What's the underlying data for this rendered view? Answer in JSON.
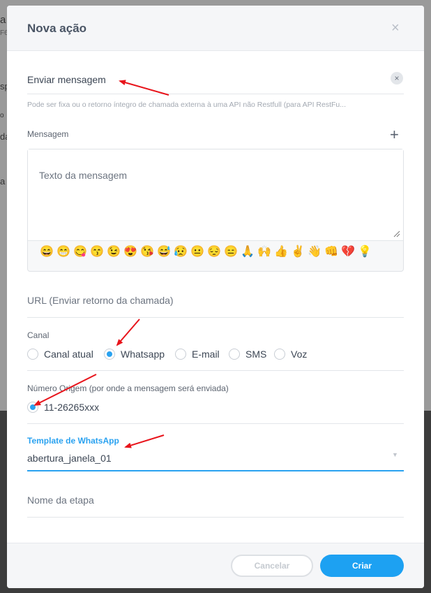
{
  "background": {
    "fragments": [
      "a",
      "F6",
      "sp",
      "o",
      "da",
      "a"
    ]
  },
  "modal": {
    "title": "Nova ação",
    "close_glyph": "×"
  },
  "action_field": {
    "value": "Enviar mensagem",
    "clear_glyph": "×",
    "hint": "Pode ser fixa ou o retorno íntegro de chamada externa à uma API não Restfull (para API RestFu..."
  },
  "message": {
    "label": "Mensagem",
    "add_glyph": "+",
    "placeholder": "Texto da mensagem",
    "emojis": [
      "😄",
      "😁",
      "😋",
      "😙",
      "😉",
      "😍",
      "😘",
      "😅",
      "😥",
      "😐",
      "😔",
      "😑",
      "🙏",
      "🙌",
      "👍",
      "✌",
      "👋",
      "👊",
      "💔",
      "💡"
    ]
  },
  "url_field": {
    "placeholder": "URL (Enviar retorno da chamada)"
  },
  "channel": {
    "label": "Canal",
    "options": [
      {
        "label": "Canal atual",
        "checked": false
      },
      {
        "label": "Whatsapp",
        "checked": true
      },
      {
        "label": "E-mail",
        "checked": false
      },
      {
        "label": "SMS",
        "checked": false
      },
      {
        "label": "Voz",
        "checked": false
      }
    ]
  },
  "origin_number": {
    "label": "Número Origem (por onde a mensagem será enviada)",
    "options": [
      {
        "label": "11-26265xxx",
        "checked": true
      }
    ]
  },
  "whatsapp_template": {
    "label": "Template de WhatsApp",
    "value": "abertura_janela_01",
    "caret_glyph": "▼"
  },
  "step_name": {
    "placeholder": "Nome da etapa"
  },
  "footer": {
    "cancel_label": "Cancelar",
    "create_label": "Criar"
  },
  "colors": {
    "accent": "#2aa2f0",
    "primary_button": "#1da1f2",
    "annotation_arrow": "#e8141b"
  }
}
